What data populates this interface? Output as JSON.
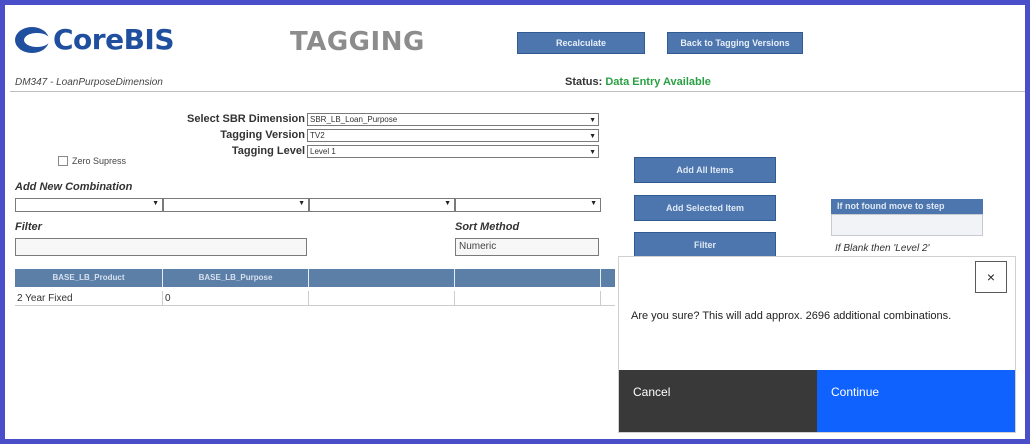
{
  "header": {
    "logo_text": "CoreBIS",
    "page_title": "TAGGING",
    "recalculate_label": "Recalculate",
    "back_label": "Back to Tagging Versions",
    "subtitle": "DM347 - LoanPurposeDimension",
    "status_label": "Status:",
    "status_value": "Data Entry Available",
    "status_color": "#2aa043"
  },
  "form": {
    "sbr_dimension_label": "Select SBR Dimension",
    "sbr_dimension_value": "SBR_LB_Loan_Purpose",
    "tagging_version_label": "Tagging Version",
    "tagging_version_value": "TV2",
    "tagging_level_label": "Tagging Level",
    "tagging_level_value": "Level 1",
    "zero_supress_label": "Zero Supress",
    "add_new_combination_label": "Add New Combination",
    "filter_label": "Filter",
    "filter_value": "",
    "sort_method_label": "Sort Method",
    "sort_method_value": "Numeric"
  },
  "actions": {
    "add_all_label": "Add All Items",
    "add_selected_label": "Add Selected Item",
    "filter_button_label": "Filter"
  },
  "step_panel": {
    "header": "If not found move to step",
    "note": "If Blank then 'Level 2'"
  },
  "table": {
    "columns": [
      "BASE_LB_Product",
      "BASE_LB_Purpose",
      "",
      ""
    ],
    "rows": [
      [
        "2 Year Fixed",
        "0",
        "",
        ""
      ]
    ]
  },
  "dialog": {
    "message": "Are you sure? This will add approx. 2696 additional combinations.",
    "close_glyph": "×",
    "cancel_label": "Cancel",
    "continue_label": "Continue",
    "continue_color": "#0f62fe"
  }
}
